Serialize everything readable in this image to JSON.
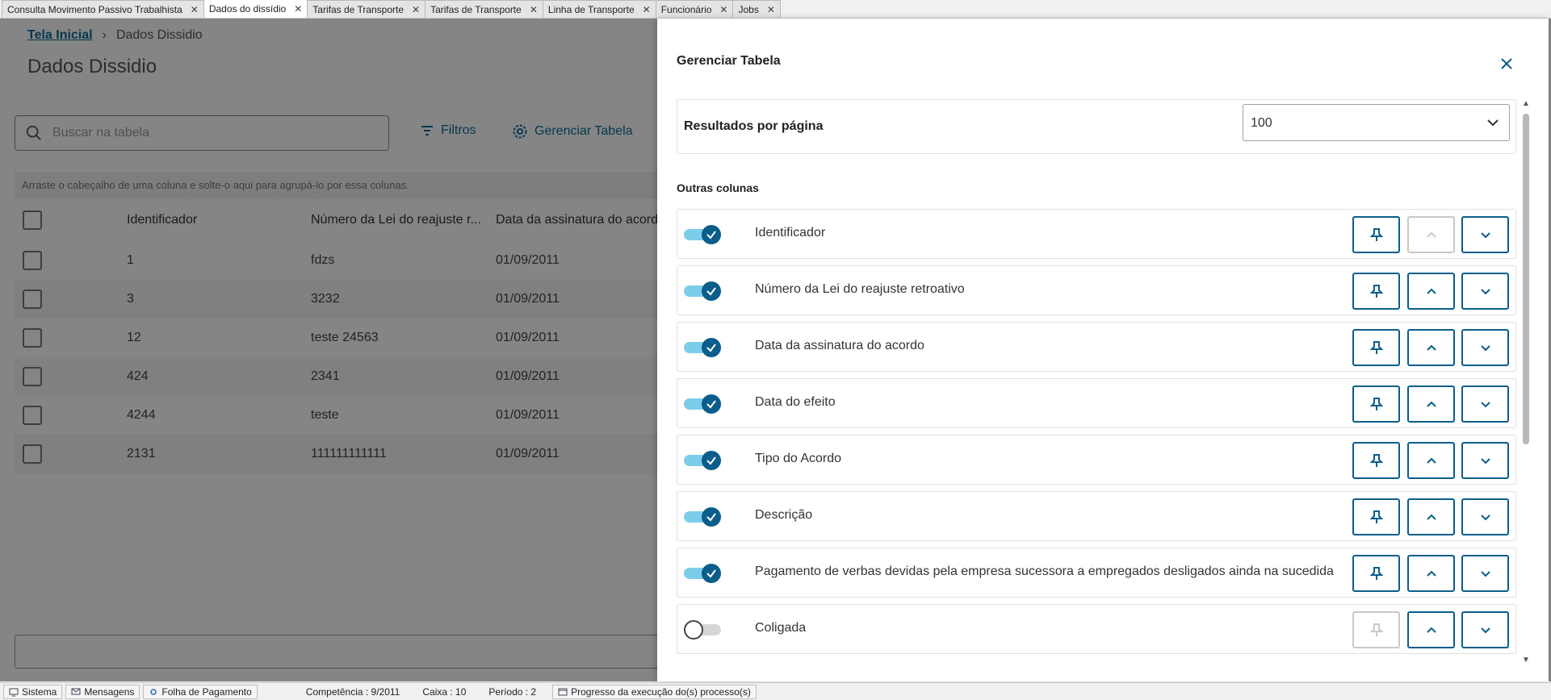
{
  "tabs": [
    {
      "label": "Consulta Movimento Passivo Trabalhista"
    },
    {
      "label": "Dados do dissídio"
    },
    {
      "label": "Tarifas de Transporte"
    },
    {
      "label": "Tarifas de Transporte"
    },
    {
      "label": "Linha de Transporte"
    },
    {
      "label": "Funcionário"
    },
    {
      "label": "Jobs"
    }
  ],
  "breadcrumb": {
    "home": "Tela Inicial",
    "current": "Dados Dissidio"
  },
  "page": {
    "title": "Dados Dissidio"
  },
  "toolbar": {
    "search_placeholder": "Buscar na tabela",
    "filters_label": "Filtros",
    "manage_label": "Gerenciar Tabela"
  },
  "grid": {
    "group_hint": "Arraste o cabeçalho de uma coluna e solte-o aqui para agrupá-lo por essa colunas.",
    "headers": [
      "Identificador",
      "Número da Lei do reajuste r...",
      "Data da assinatura do acord"
    ],
    "rows": [
      [
        "1",
        "fdzs",
        "01/09/2011"
      ],
      [
        "3",
        "3232",
        "01/09/2011"
      ],
      [
        "12",
        "teste 24563",
        "01/09/2011"
      ],
      [
        "424",
        "2341",
        "01/09/2011"
      ],
      [
        "4244",
        "teste",
        "01/09/2011"
      ],
      [
        "2131",
        "111111111111",
        "01/09/2011"
      ]
    ]
  },
  "drawer": {
    "title": "Gerenciar Tabela",
    "results_per_page_label": "Resultados por página",
    "results_per_page_value": "100",
    "other_columns_label": "Outras colunas",
    "columns": [
      {
        "label": "Identificador",
        "enabled": true
      },
      {
        "label": "Número da Lei do reajuste retroativo",
        "enabled": true
      },
      {
        "label": "Data da assinatura do acordo",
        "enabled": true
      },
      {
        "label": "Data do efeito",
        "enabled": true
      },
      {
        "label": "Tipo do Acordo",
        "enabled": true
      },
      {
        "label": "Descrição",
        "enabled": true
      },
      {
        "label": "Pagamento de verbas devidas pela empresa sucessora a empregados desligados ainda na sucedida",
        "enabled": true
      },
      {
        "label": "Coligada",
        "enabled": false
      }
    ]
  },
  "statusbar": {
    "sistema": "Sistema",
    "mensagens": "Mensagens",
    "folha": "Folha de Pagamento",
    "competencia": "Competência : 9/2011",
    "caixa": "Caixa : 10",
    "periodo": "Período : 2",
    "progresso": "Progresso da execução do(s) processo(s)"
  },
  "colors": {
    "accent": "#0c5e8a",
    "link": "#0c6c94",
    "toggle_track": "#7ccde7"
  }
}
